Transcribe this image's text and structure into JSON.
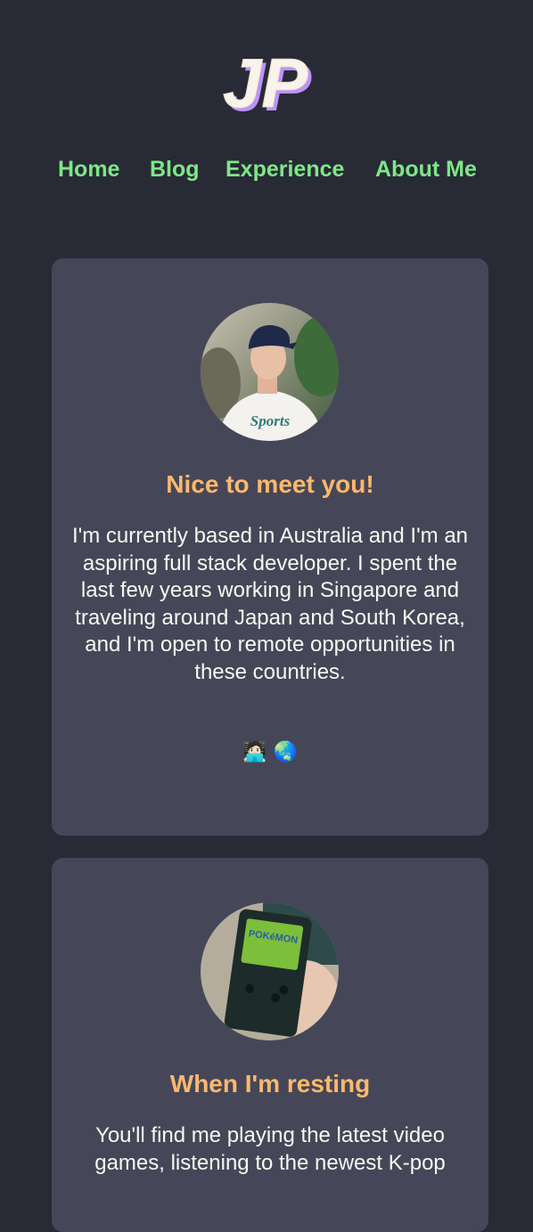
{
  "logo": {
    "text": "JP",
    "icon": "jp-logo-icon"
  },
  "nav": {
    "items": [
      {
        "label": "Home"
      },
      {
        "label": "Blog"
      },
      {
        "label": "Experience"
      },
      {
        "label": "About Me"
      }
    ]
  },
  "cards": [
    {
      "title": "Nice to meet you!",
      "body": "I'm currently based in Australia and I'm an aspiring full stack developer. I spent the last few years working in Singapore and traveling around Japan and South Korea, and I'm open to remote opportunities in these countries.",
      "emoji": "🧑🏻‍💻 🌏",
      "image": "portrait-photo"
    },
    {
      "title": "When I'm resting",
      "body": "You'll find me playing the latest video games, listening to the newest K-pop",
      "image": "handheld-console-photo"
    }
  ],
  "colors": {
    "background": "#282a36",
    "card": "#454758",
    "nav": "#7ee787",
    "heading": "#ffb86c"
  }
}
